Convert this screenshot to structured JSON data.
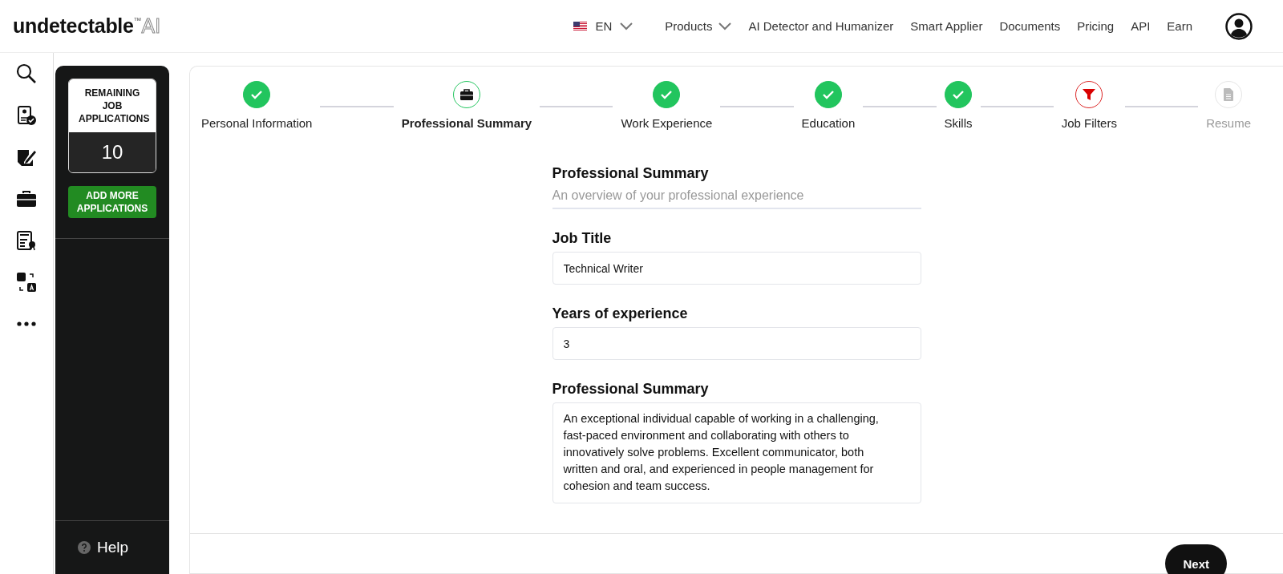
{
  "header": {
    "logo": {
      "word": "undetectable",
      "trademark": "™",
      "suffix": "AI"
    },
    "language": "EN",
    "nav": [
      {
        "label": "Products",
        "dropdown": true
      },
      {
        "label": "AI Detector and Humanizer",
        "dropdown": false
      },
      {
        "label": "Smart Applier",
        "dropdown": false
      },
      {
        "label": "Documents",
        "dropdown": false
      },
      {
        "label": "Pricing",
        "dropdown": false
      },
      {
        "label": "API",
        "dropdown": false
      },
      {
        "label": "Earn",
        "dropdown": false
      }
    ]
  },
  "rail": [
    {
      "kind": "ai-search"
    },
    {
      "kind": "profile-check"
    },
    {
      "kind": "edit"
    },
    {
      "kind": "briefcase"
    },
    {
      "kind": "seo"
    },
    {
      "kind": "translate"
    },
    {
      "kind": "more"
    }
  ],
  "applications": {
    "title": "REMAINING JOB APPLICATIONS",
    "count": "10",
    "button": "ADD MORE APPLICATIONS",
    "help": "Help"
  },
  "steps": [
    {
      "label": "Personal Information",
      "kind": "complete",
      "selected": false
    },
    {
      "label": "Professional Summary",
      "kind": "active",
      "selected": true
    },
    {
      "label": "Work Experience",
      "kind": "complete",
      "selected": false
    },
    {
      "label": "Education",
      "kind": "complete",
      "selected": false
    },
    {
      "label": "Skills",
      "kind": "complete",
      "selected": false
    },
    {
      "label": "Job Filters",
      "kind": "attention",
      "selected": false
    },
    {
      "label": "Resume",
      "kind": "pending",
      "selected": false
    }
  ],
  "form": {
    "title": "Professional Summary",
    "subtitle": "An overview of your professional experience",
    "fields": [
      {
        "label": "Job Title",
        "value": "Technical Writer",
        "kind": "input"
      },
      {
        "label": "Years of experience",
        "value": "3",
        "kind": "input"
      },
      {
        "label": "Professional Summary",
        "value": "An exceptional individual capable of working in a challenging, fast-paced environment and collaborating with others to innovatively solve problems. Excellent communicator, both written and oral, and experienced in people management for cohesion and team success.",
        "kind": "textarea"
      }
    ]
  },
  "footer": {
    "next": "Next"
  }
}
